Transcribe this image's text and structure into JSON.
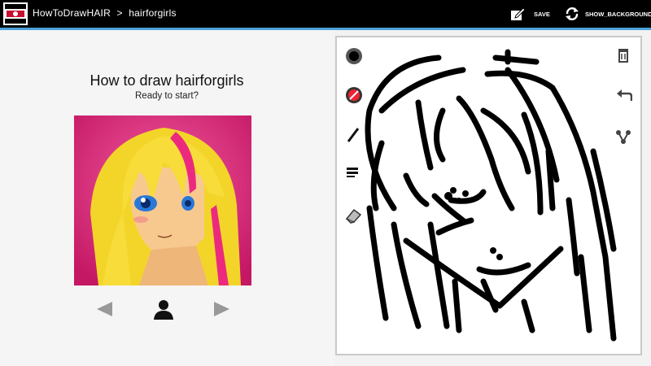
{
  "actionbar": {
    "app_name": "HowToDrawHAIR",
    "separator": ">",
    "section": "hairforgirls",
    "save_label": "SAVE",
    "show_background_label": "SHOW_BACKGROUND"
  },
  "lesson": {
    "title": "How to draw hairforgirls",
    "subtitle": "Ready to start?"
  },
  "icons": {
    "app": "app-logo-icon",
    "save": "save-icon",
    "show_background": "refresh-icon",
    "previous": "left-arrow-icon",
    "person": "person-icon",
    "next": "right-arrow-icon",
    "brush_size": "brush-size-icon",
    "color": "color-picker-icon",
    "pen": "pen-icon",
    "eraser": "eraser-icon",
    "delete": "trash-icon",
    "undo": "undo-icon",
    "share": "share-icon"
  },
  "colors": {
    "actionbar": "#000000",
    "accent_divider": "#4aa3d9",
    "preview_background": "#d0226e",
    "hair": "#f3d52a",
    "hair_streak": "#ec2a7d"
  }
}
